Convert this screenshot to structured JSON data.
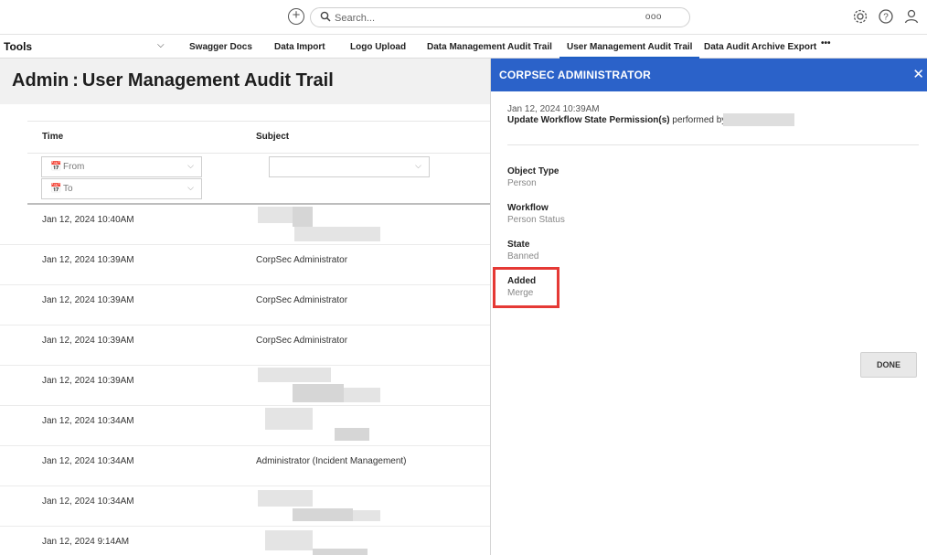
{
  "topbar": {
    "search_placeholder": "Search...",
    "search_more": "ooo"
  },
  "nav": {
    "tools_label": "Tools",
    "items": [
      {
        "label": "Swagger Docs"
      },
      {
        "label": "Data Import"
      },
      {
        "label": "Logo Upload"
      },
      {
        "label": "Data Management Audit Trail"
      },
      {
        "label": "User Management Audit Trail",
        "active": true
      },
      {
        "label": "Data Audit Archive Export"
      },
      {
        "label": "•••"
      }
    ]
  },
  "page": {
    "title": "Admin : User Management Audit Trail"
  },
  "table": {
    "columns": [
      "Time",
      "Subject"
    ],
    "filters": {
      "from_label": "From",
      "to_label": "To"
    },
    "rows": [
      {
        "time": "Jan 12, 2024 10:40AM",
        "subject": ""
      },
      {
        "time": "Jan 12, 2024 10:39AM",
        "subject": "CorpSec Administrator"
      },
      {
        "time": "Jan 12, 2024 10:39AM",
        "subject": "CorpSec Administrator"
      },
      {
        "time": "Jan 12, 2024 10:39AM",
        "subject": "CorpSec Administrator"
      },
      {
        "time": "Jan 12, 2024 10:39AM",
        "subject": ""
      },
      {
        "time": "Jan 12, 2024 10:34AM",
        "subject": ""
      },
      {
        "time": "Jan 12, 2024 10:34AM",
        "subject": "Administrator (Incident Management)"
      },
      {
        "time": "Jan 12, 2024 10:34AM",
        "subject": ""
      },
      {
        "time": "Jan 12, 2024 9:14AM",
        "subject": ""
      }
    ]
  },
  "panel": {
    "title": "CORPSEC ADMINISTRATOR",
    "timestamp": "Jan 12, 2024 10:39AM",
    "action_bold": "Update Workflow State Permission(s)",
    "action_suffix": " performed by",
    "fields": [
      {
        "label": "Object Type",
        "value": "Person"
      },
      {
        "label": "Workflow",
        "value": "Person Status"
      },
      {
        "label": "State",
        "value": "Banned"
      },
      {
        "label": "Added",
        "value": "Merge"
      }
    ],
    "done_label": "DONE"
  },
  "colors": {
    "accent": "#2b62c9",
    "highlight": "#e53935"
  }
}
